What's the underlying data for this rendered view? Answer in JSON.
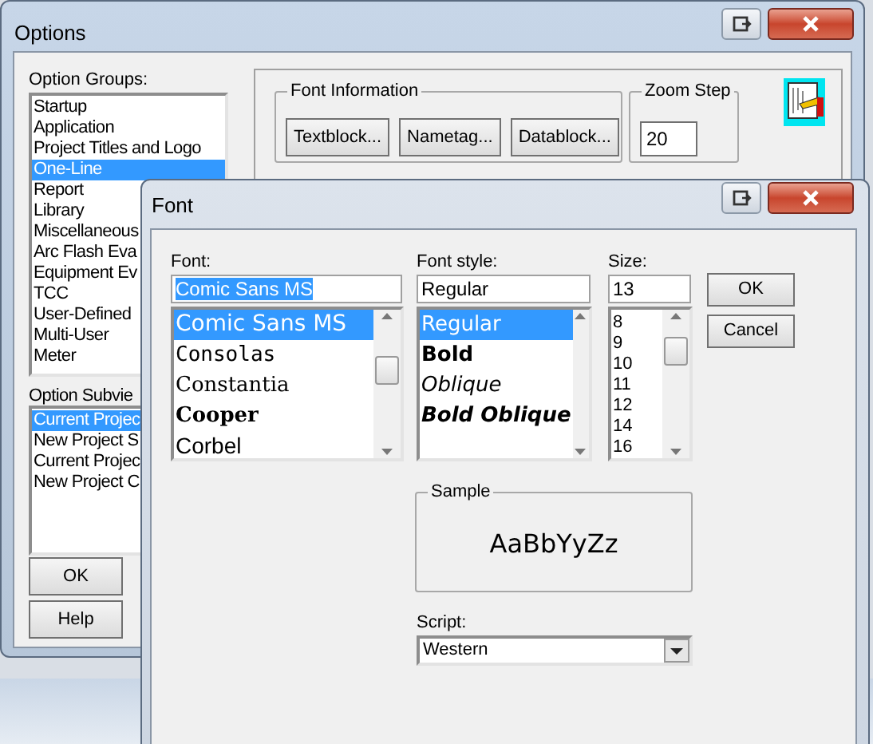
{
  "options_window": {
    "title": "Options",
    "option_groups": {
      "label": "Option Groups:",
      "items": [
        {
          "label": "Startup",
          "selected": false
        },
        {
          "label": "Application",
          "selected": false
        },
        {
          "label": "Project Titles and Logo",
          "selected": false
        },
        {
          "label": "One-Line",
          "selected": true
        },
        {
          "label": "Report",
          "selected": false
        },
        {
          "label": "Library",
          "selected": false
        },
        {
          "label": "Miscellaneous",
          "selected": false
        },
        {
          "label": "Arc Flash Eva",
          "selected": false
        },
        {
          "label": "Equipment Ev",
          "selected": false
        },
        {
          "label": "TCC",
          "selected": false
        },
        {
          "label": "User-Defined",
          "selected": false
        },
        {
          "label": "Multi-User",
          "selected": false
        },
        {
          "label": "Meter",
          "selected": false
        }
      ]
    },
    "option_subview": {
      "label": "Option Subvie",
      "items": [
        {
          "label": "Current Projec",
          "selected": true
        },
        {
          "label": "New Project S",
          "selected": false
        },
        {
          "label": "Current Projec",
          "selected": false
        },
        {
          "label": "New Project C",
          "selected": false
        }
      ]
    },
    "buttons": [
      "OK",
      "Help"
    ],
    "font_information": {
      "label": "Font Information",
      "buttons": [
        "Textblock...",
        "Nametag...",
        "Datablock..."
      ]
    },
    "zoom_step": {
      "label": "Zoom Step",
      "value": "20"
    }
  },
  "font_dialog": {
    "title": "Font",
    "font": {
      "label": "Font:",
      "value": "Comic Sans MS",
      "items": [
        {
          "label": "Comic Sans MS",
          "kind": "comic",
          "selected": true
        },
        {
          "label": "Consolas",
          "kind": "mono",
          "selected": false
        },
        {
          "label": "Constantia",
          "kind": "serif",
          "selected": false
        },
        {
          "label": "Cooper",
          "kind": "heavy",
          "selected": false
        },
        {
          "label": "Corbel",
          "kind": "sans",
          "selected": false
        }
      ]
    },
    "font_style": {
      "label": "Font style:",
      "value": "Regular",
      "items": [
        {
          "label": "Regular",
          "kind": "regular",
          "selected": true
        },
        {
          "label": "Bold",
          "kind": "bold",
          "selected": false
        },
        {
          "label": "Oblique",
          "kind": "oblique",
          "selected": false
        },
        {
          "label": "Bold Oblique",
          "kind": "bold-oblique",
          "selected": false
        }
      ]
    },
    "size": {
      "label": "Size:",
      "value": "13",
      "items": [
        {
          "label": "8",
          "selected": false
        },
        {
          "label": "9",
          "selected": false
        },
        {
          "label": "10",
          "selected": false
        },
        {
          "label": "11",
          "selected": false
        },
        {
          "label": "12",
          "selected": false
        },
        {
          "label": "14",
          "selected": false
        },
        {
          "label": "16",
          "selected": false
        }
      ]
    },
    "buttons": [
      "OK",
      "Cancel"
    ],
    "sample": {
      "label": "Sample",
      "text": "AaBbYyZz"
    },
    "script": {
      "label": "Script:",
      "value": "Western"
    }
  }
}
